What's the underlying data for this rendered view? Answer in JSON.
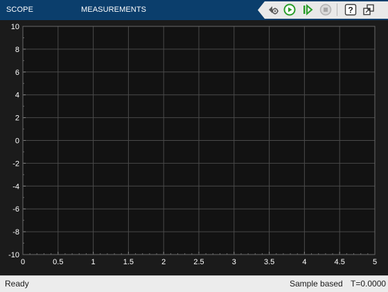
{
  "toolstrip": {
    "tabs": [
      {
        "label": "SCOPE",
        "icon": null
      },
      {
        "label": "MEASUREMENTS",
        "icon": null
      }
    ],
    "buttons": [
      {
        "name": "settings-gear-icon"
      },
      {
        "name": "run-icon",
        "color": "#2a9d2a"
      },
      {
        "name": "step-forward-icon",
        "color": "#2a9d2a"
      },
      {
        "name": "stop-icon",
        "state": "disabled"
      },
      {
        "name": "help-icon"
      },
      {
        "name": "undock-icon"
      }
    ]
  },
  "chart_data": {
    "type": "line",
    "title": "",
    "xlabel": "",
    "ylabel": "",
    "xlim": [
      0,
      5
    ],
    "ylim": [
      -10,
      10
    ],
    "xticks": [
      "0",
      "0.5",
      "1",
      "1.5",
      "2",
      "2.5",
      "3",
      "3.5",
      "4",
      "4.5",
      "5"
    ],
    "yticks": [
      "10",
      "8",
      "6",
      "4",
      "2",
      "0",
      "-2",
      "-4",
      "-6",
      "-8",
      "-10"
    ],
    "grid": true,
    "series": [],
    "colors": {
      "background": "#121212",
      "axes": "#1b1b1b",
      "grid": "#4a4a4a",
      "text": "#ffffff"
    }
  },
  "status": {
    "state": "Ready",
    "mode": "Sample based",
    "time": "T=0.0000"
  }
}
